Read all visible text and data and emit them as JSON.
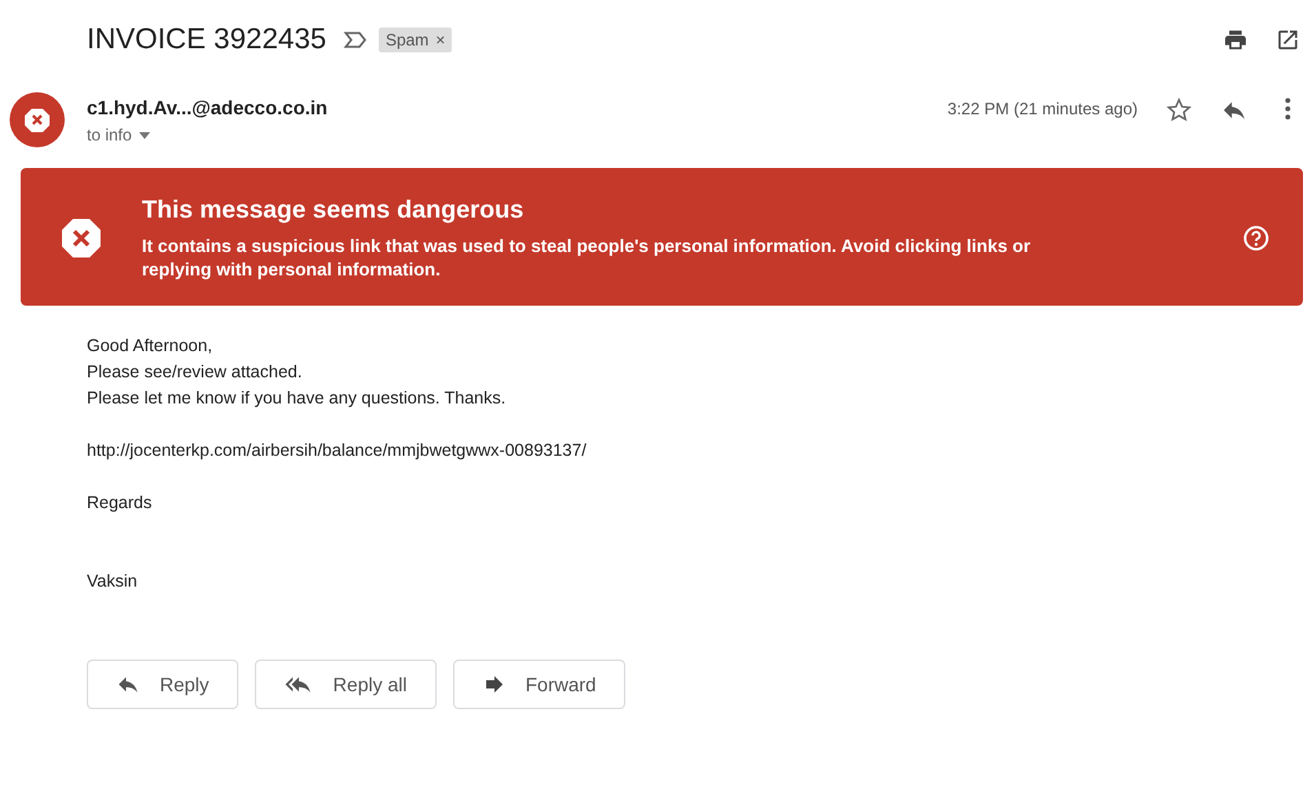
{
  "subject": "INVOICE 3922435",
  "label": {
    "text": "Spam",
    "close": "×"
  },
  "sender": {
    "address": "c1.hyd.Av...@adecco.co.in",
    "recipient": "to info",
    "time": "3:22 PM (21 minutes ago)",
    "starred": false
  },
  "warning": {
    "title": "This message seems dangerous",
    "text": "It contains a suspicious link that was used to steal people's personal information. Avoid clicking links or replying with personal information."
  },
  "body": [
    {
      "kind": "text",
      "lines": [
        "Good Afternoon,",
        "Please see/review attached.",
        "Please let me know if you have any questions. Thanks."
      ]
    },
    {
      "kind": "text",
      "lines": [
        "http://jocenterkp.com/airbersih/balance/mmjbwetgwwx-00893137/"
      ]
    },
    {
      "kind": "text",
      "lines": [
        "Regards"
      ]
    },
    {
      "kind": "signature",
      "lines": [
        "Vaksin"
      ]
    }
  ],
  "actions": [
    {
      "kind": "reply",
      "label": "Reply"
    },
    {
      "kind": "reply_all",
      "label": "Reply all"
    },
    {
      "kind": "forward",
      "label": "Forward"
    }
  ]
}
